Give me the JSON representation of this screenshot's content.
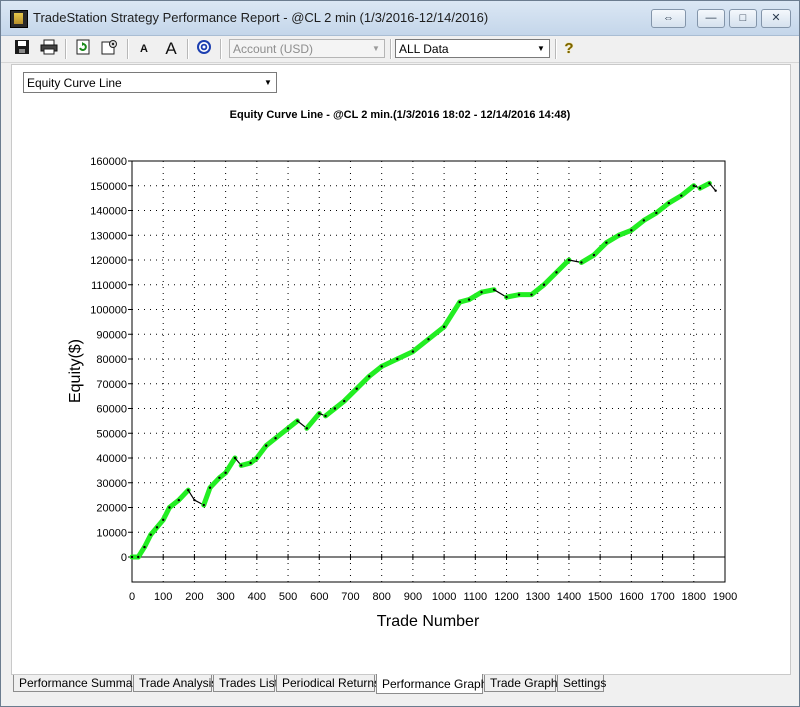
{
  "window": {
    "title": "TradeStation Strategy Performance Report - @CL 2 min (1/3/2016-12/14/2016)",
    "controls": {
      "restore": "⇔",
      "minimize": "—",
      "maximize": "□",
      "close": "✕"
    }
  },
  "toolbar": {
    "icons": [
      "save-icon",
      "print-icon",
      "refresh-icon",
      "settings-icon",
      "decrease-font-icon",
      "increase-font-icon",
      "target-icon",
      "help-icon"
    ],
    "decrease_font": "A",
    "increase_font": "A",
    "help": "?",
    "account_select": "Account (USD)",
    "data_select": "ALL Data"
  },
  "graph_select": {
    "value": "Equity Curve Line"
  },
  "tabs": [
    {
      "label": "Performance Summary"
    },
    {
      "label": "Trade Analysis"
    },
    {
      "label": "Trades List"
    },
    {
      "label": "Periodical Returns"
    },
    {
      "label": "Performance Graphs"
    },
    {
      "label": "Trade Graphs"
    },
    {
      "label": "Settings"
    }
  ],
  "active_tab": "Performance Graphs",
  "colors": {
    "gain": "#22ee22",
    "loss": "#000000",
    "grid": "#000000"
  },
  "chart_data": {
    "type": "line",
    "title": "Equity Curve Line - @CL 2 min.(1/3/2016 18:02 - 12/14/2016 14:48)",
    "xlabel": "Trade Number",
    "ylabel": "Equity($)",
    "xlim": [
      0,
      1900
    ],
    "ylim": [
      0,
      160000
    ],
    "x_ticks": [
      0,
      100,
      200,
      300,
      400,
      500,
      600,
      700,
      800,
      900,
      1000,
      1100,
      1200,
      1300,
      1400,
      1500,
      1600,
      1700,
      1800,
      1900
    ],
    "y_ticks": [
      0,
      10000,
      20000,
      30000,
      40000,
      50000,
      60000,
      70000,
      80000,
      90000,
      100000,
      110000,
      120000,
      130000,
      140000,
      150000,
      160000
    ],
    "y_tick_labels": [
      "0",
      "10000",
      "20000",
      "30000",
      "40000",
      "50000",
      "60000",
      "70000",
      "80000",
      "90000",
      "100000",
      "110000",
      "120000",
      "130000",
      "140000",
      "150000",
      "160000"
    ],
    "grid": true,
    "series": [
      {
        "name": "",
        "x": [
          0,
          20,
          40,
          60,
          80,
          100,
          120,
          150,
          180,
          200,
          230,
          250,
          280,
          300,
          330,
          350,
          380,
          400,
          430,
          460,
          500,
          530,
          560,
          600,
          620,
          650,
          680,
          720,
          760,
          800,
          850,
          900,
          950,
          1000,
          1050,
          1080,
          1120,
          1160,
          1200,
          1240,
          1280,
          1320,
          1360,
          1400,
          1440,
          1480,
          1520,
          1560,
          1600,
          1640,
          1680,
          1720,
          1760,
          1800,
          1820,
          1850,
          1870
        ],
        "y": [
          0,
          0,
          4000,
          9000,
          12000,
          15000,
          20000,
          23000,
          27000,
          23000,
          21000,
          28000,
          32000,
          34000,
          40000,
          37000,
          38000,
          40000,
          45000,
          48000,
          52000,
          55000,
          52000,
          58000,
          57000,
          60000,
          63000,
          68000,
          73000,
          77000,
          80000,
          83000,
          88000,
          93000,
          103000,
          104000,
          107000,
          108000,
          105000,
          106000,
          106000,
          110000,
          115000,
          120000,
          119000,
          122000,
          127000,
          130000,
          132000,
          136000,
          139000,
          143000,
          146000,
          150000,
          149000,
          151000,
          148000
        ]
      }
    ]
  }
}
